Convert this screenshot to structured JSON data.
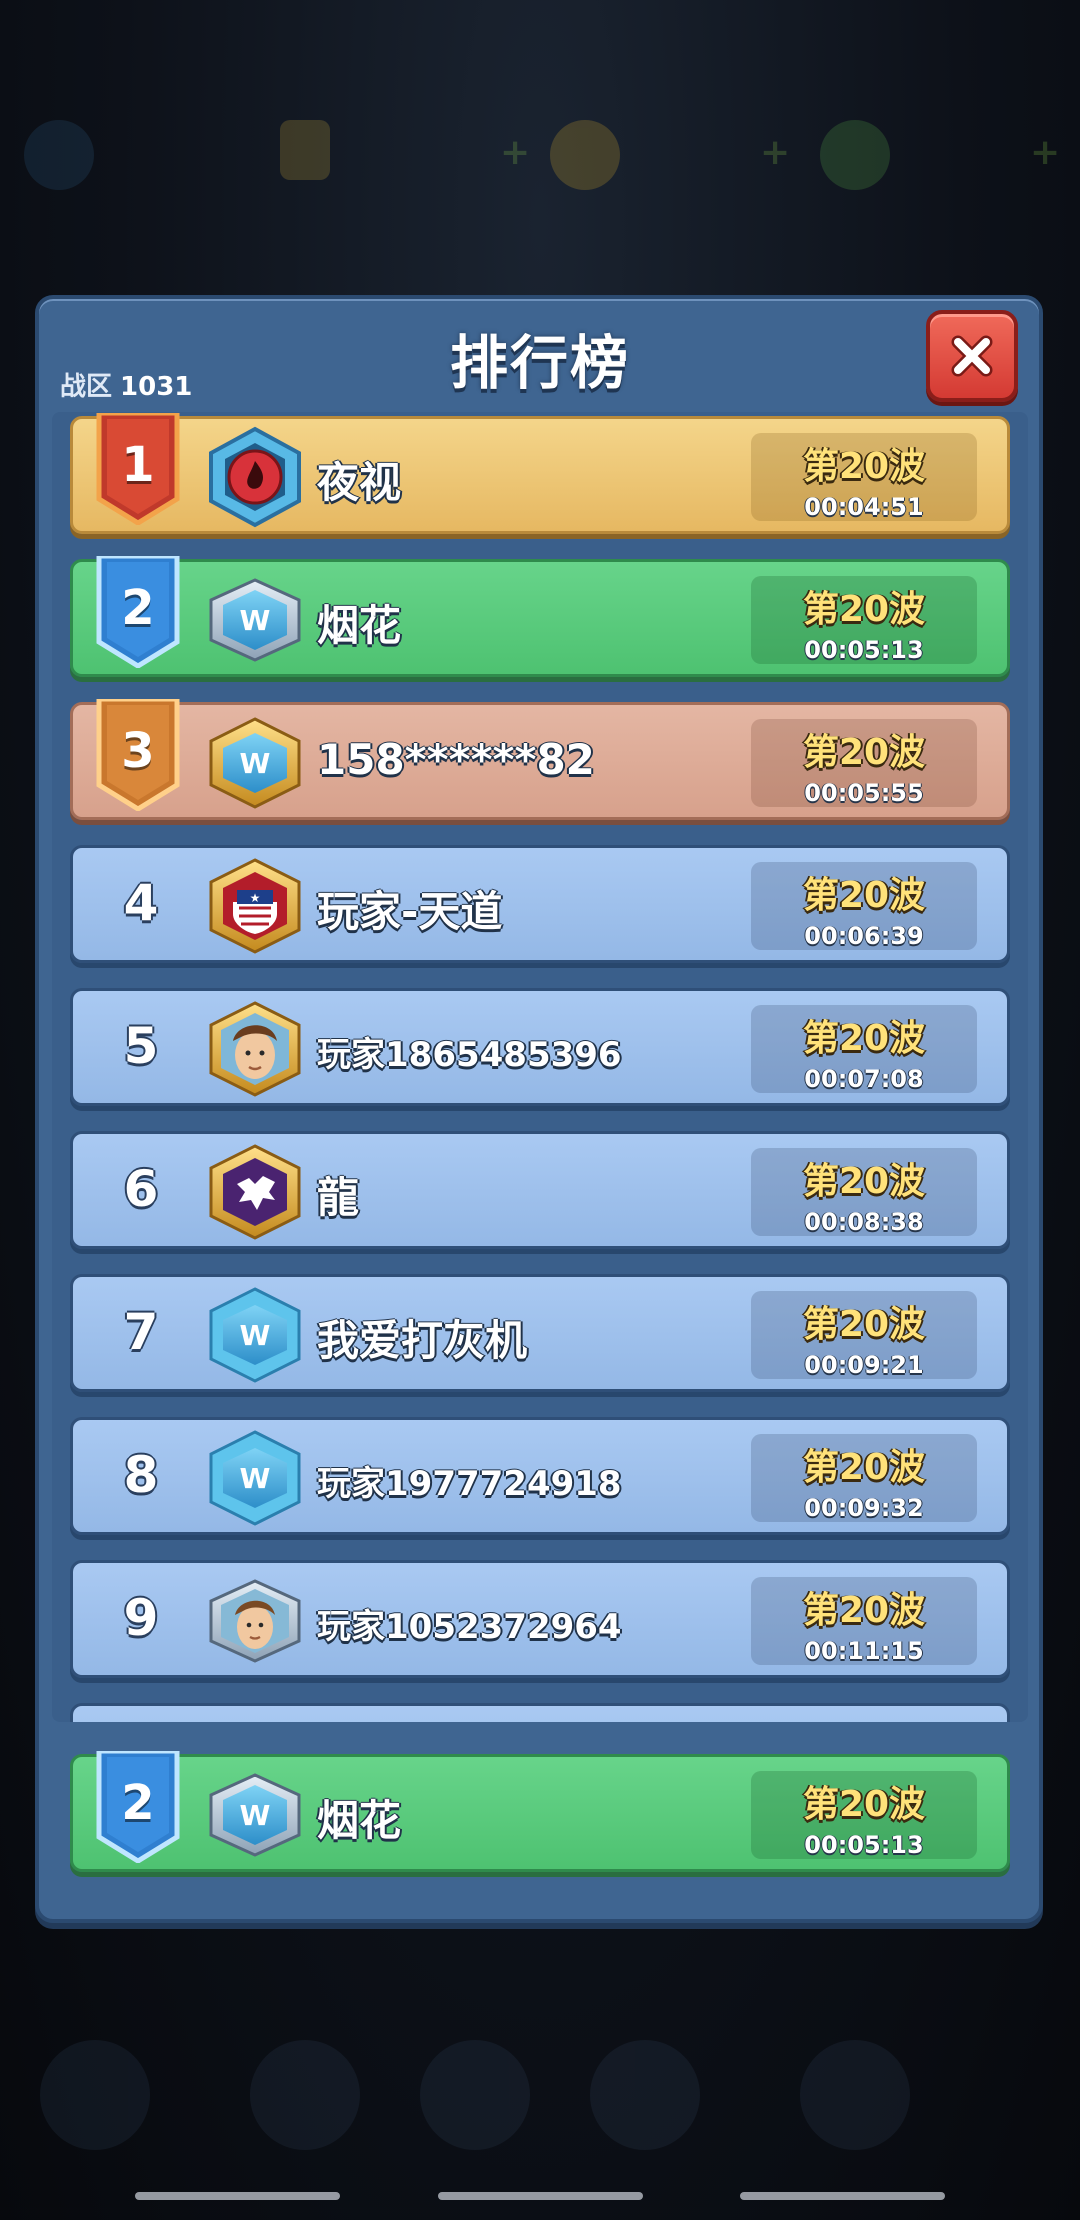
{
  "title": "排行榜",
  "zone": {
    "label": "战区",
    "number": "1031"
  },
  "ranks": [
    {
      "rank": "1",
      "name": "夜视",
      "wave": "第20波",
      "time": "00:04:51"
    },
    {
      "rank": "2",
      "name": "烟花",
      "wave": "第20波",
      "time": "00:05:13"
    },
    {
      "rank": "3",
      "name": "158******82",
      "wave": "第20波",
      "time": "00:05:55"
    },
    {
      "rank": "4",
      "name": "玩家-天道",
      "wave": "第20波",
      "time": "00:06:39"
    },
    {
      "rank": "5",
      "name": "玩家1865485396",
      "wave": "第20波",
      "time": "00:07:08"
    },
    {
      "rank": "6",
      "name": "龍",
      "wave": "第20波",
      "time": "00:08:38"
    },
    {
      "rank": "7",
      "name": "我爱打灰机",
      "wave": "第20波",
      "time": "00:09:21"
    },
    {
      "rank": "8",
      "name": "玩家1977724918",
      "wave": "第20波",
      "time": "00:09:32"
    },
    {
      "rank": "9",
      "name": "玩家1052372964",
      "wave": "第20波",
      "time": "00:11:15"
    }
  ],
  "self": {
    "rank": "2",
    "name": "烟花",
    "wave": "第20波",
    "time": "00:05:13"
  },
  "icons": {
    "close": "close-x-icon",
    "rank1_avatar": "fire-shield-icon",
    "rank4_avatar": "star-shield-icon",
    "rank6_avatar": "tiger-emblem-icon",
    "default_avatar": "w-logo-badge-icon",
    "face_avatar": "player-portrait-icon"
  },
  "colors": {
    "panel": "#3f6591",
    "gold_row": "#f4d58a",
    "green_row": "#67d48a",
    "bronze_row": "#e4b6a3",
    "plain_row": "#a9c9f2",
    "wave_text": "#ffe27a",
    "close_button": "#e04a40"
  }
}
